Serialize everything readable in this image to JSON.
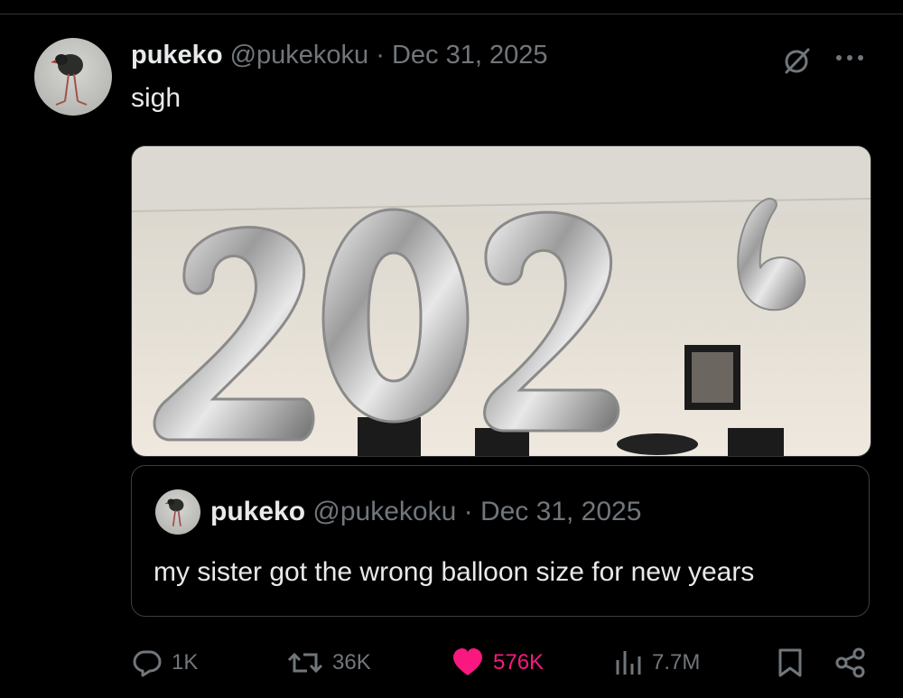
{
  "post": {
    "author_name": "pukeko",
    "author_handle": "@pukekoku",
    "separator": "·",
    "date": "Dec 31, 2025",
    "text": "sigh"
  },
  "media": {
    "balloon_digits": [
      "2",
      "0",
      "2",
      "6"
    ]
  },
  "quoted_post": {
    "author_name": "pukeko",
    "author_handle": "@pukekoku",
    "separator": "·",
    "date": "Dec 31, 2025",
    "text": "my sister got the wrong balloon size for new years"
  },
  "actions": {
    "replies": "1K",
    "reposts": "36K",
    "likes": "576K",
    "views": "7.7M"
  },
  "icons": {
    "grok": "grok-icon",
    "more": "more-icon",
    "reply": "reply-icon",
    "repost": "repost-icon",
    "like": "heart-icon",
    "views": "views-icon",
    "bookmark": "bookmark-icon",
    "share": "share-icon"
  },
  "colors": {
    "background": "#000000",
    "text_primary": "#e7e9ea",
    "text_secondary": "#71767b",
    "like_accent": "#f91880",
    "border": "#2f3336"
  }
}
